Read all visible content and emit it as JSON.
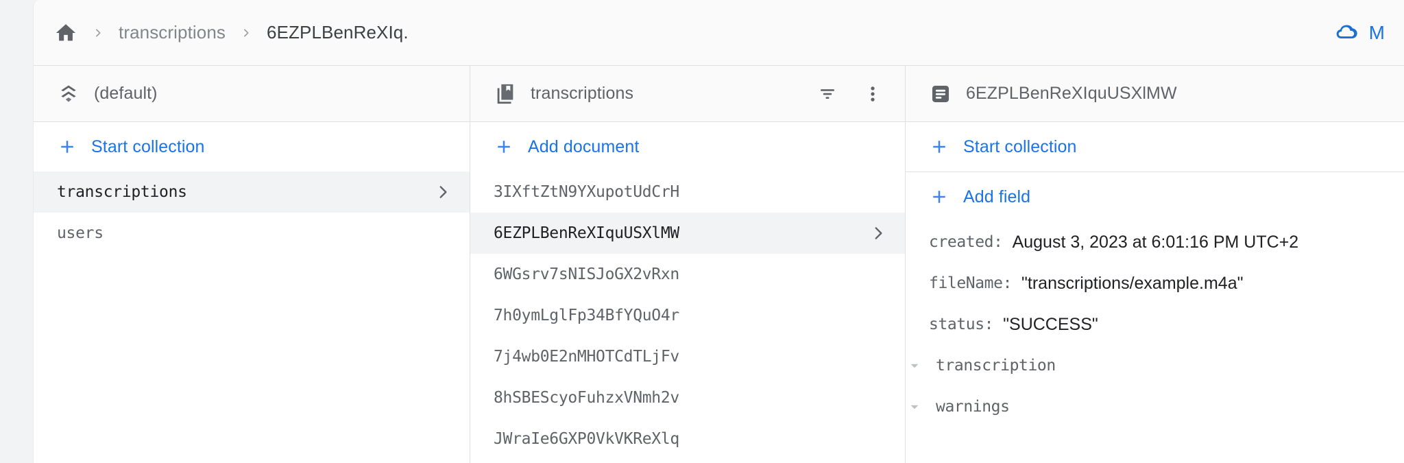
{
  "breadcrumb": {
    "home_icon": "home-icon",
    "separator_icon": "chevron-right-icon",
    "items": [
      {
        "label": "transcriptions",
        "current": false
      },
      {
        "label": "6EZPLBenReXIq.",
        "current": true
      }
    ]
  },
  "brand": {
    "icon": "google-cloud-icon",
    "label": "M",
    "color": "#1a73e8"
  },
  "left_panel": {
    "header": {
      "icon": "database-stack-icon",
      "title": "(default)"
    },
    "action": {
      "icon": "plus-icon",
      "label": "Start collection"
    },
    "items": [
      {
        "label": "transcriptions",
        "selected": true,
        "chevron": "chevron-right-icon"
      },
      {
        "label": "users",
        "selected": false,
        "chevron": null
      }
    ]
  },
  "middle_panel": {
    "header": {
      "icon": "collection-icon",
      "title": "transcriptions",
      "filter_icon": "filter-icon",
      "menu_icon": "more-vert-icon"
    },
    "action": {
      "icon": "plus-icon",
      "label": "Add document"
    },
    "documents": [
      {
        "id": "3IXftZtN9YXupotUdCrH",
        "selected": false
      },
      {
        "id": "6EZPLBenReXIquUSXlMW",
        "selected": true
      },
      {
        "id": "6WGsrv7sNISJoGX2vRxn",
        "selected": false
      },
      {
        "id": "7h0ymLglFp34BfYQuO4r",
        "selected": false
      },
      {
        "id": "7j4wb0E2nMHOTCdTLjFv",
        "selected": false
      },
      {
        "id": "8hSBEScyoFuhzxVNmh2v",
        "selected": false
      },
      {
        "id": "JWraIe6GXP0VkVKReXlq",
        "selected": false
      }
    ]
  },
  "right_panel": {
    "header": {
      "icon": "document-icon",
      "title": "6EZPLBenReXIquUSXlMW"
    },
    "start_collection": {
      "icon": "plus-icon",
      "label": "Start collection"
    },
    "add_field": {
      "icon": "plus-icon",
      "label": "Add field"
    },
    "fields": [
      {
        "key": "created:",
        "value": "August 3, 2023 at 6:01:16 PM UTC+2",
        "expandable": false
      },
      {
        "key": "fileName:",
        "value": "\"transcriptions/example.m4a\"",
        "expandable": false
      },
      {
        "key": "status:",
        "value": "\"SUCCESS\"",
        "expandable": false
      },
      {
        "key": "transcription",
        "value": "",
        "expandable": true
      },
      {
        "key": "warnings",
        "value": "",
        "expandable": true
      }
    ]
  },
  "colors": {
    "accent_blue": "#1a73e8",
    "selected_row": "#f1f3f4",
    "panel_header_bg": "#fafafa",
    "border": "#e0e0e0",
    "text_primary": "#202124",
    "text_secondary": "#5f6368",
    "text_muted": "#80868b"
  }
}
